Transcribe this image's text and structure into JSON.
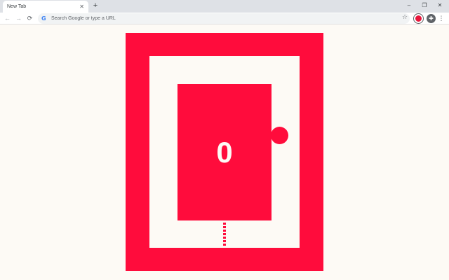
{
  "browser": {
    "tab_title": "New Tab",
    "tab_close": "✕",
    "new_tab": "+",
    "window_controls": {
      "minimize": "–",
      "restore": "❐",
      "close": "✕"
    },
    "nav": {
      "back": "←",
      "forward": "→",
      "reload": "⟳"
    },
    "omnibox": {
      "logo": "G",
      "placeholder": "Search Google or type a URL"
    },
    "bookmark": "☆",
    "menu": "⋮"
  },
  "game": {
    "score": "0",
    "colors": {
      "primary": "#ff0c3c",
      "background": "#fdfaf5"
    }
  }
}
